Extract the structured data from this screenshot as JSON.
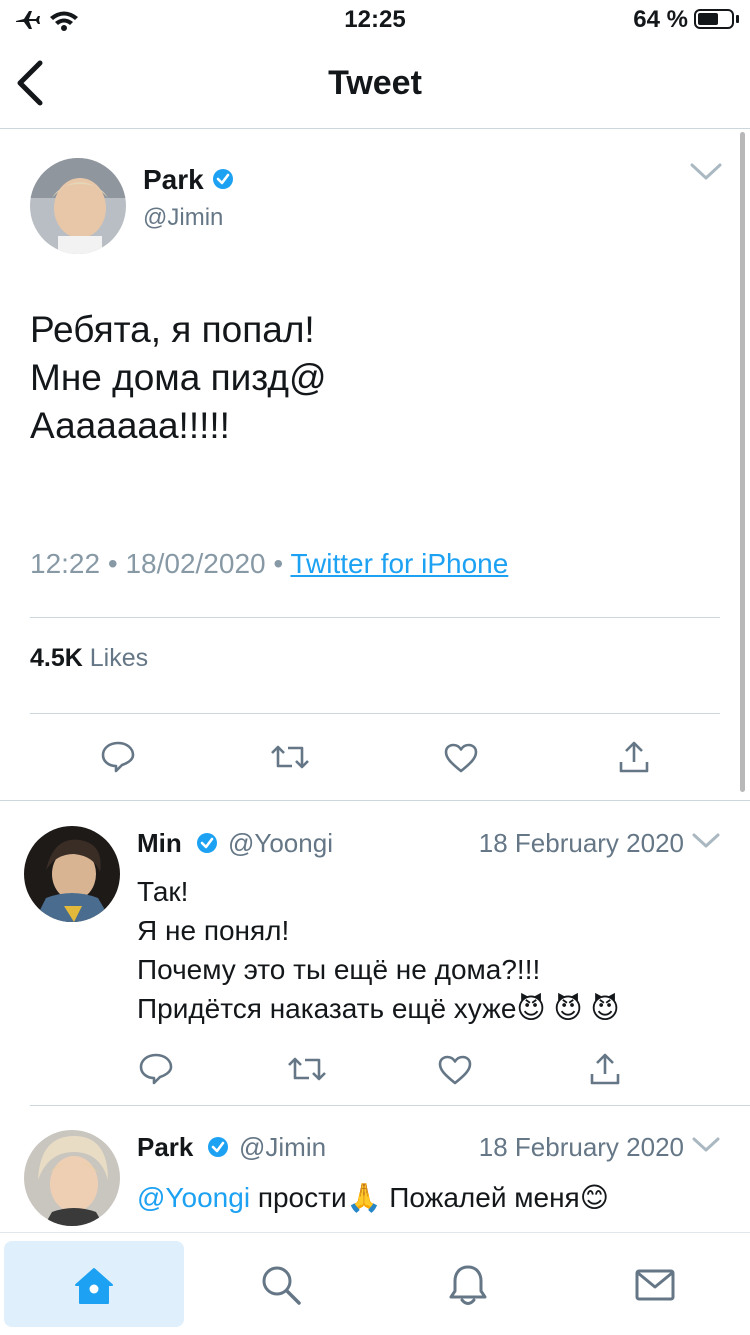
{
  "status_bar": {
    "time": "12:25",
    "battery_percent": "64 %",
    "battery_level": 0.64
  },
  "header": {
    "title": "Tweet"
  },
  "main_tweet": {
    "name": "Park",
    "handle": "@Jimin",
    "text": "Ребята, я попал!\nМне дома пизд@\nАаааааа!!!!!",
    "time": "12:22",
    "date": "18/02/2020",
    "source": "Twitter for iPhone",
    "likes_count": "4.5K",
    "likes_label": "Likes"
  },
  "replies": [
    {
      "name": "Min",
      "handle": "@Yoongi",
      "date": "18 February 2020",
      "text": "Так!\nЯ не понял!\nПочему это ты ещё не дома?!!!\nПридётся наказать ещё хуже😈 😈 😈"
    },
    {
      "name": "Park",
      "handle": "@Jimin",
      "date": "18 February 2020",
      "mention": "@Yoongi",
      "text": " прости🙏 Пожалей меня😊"
    }
  ],
  "tabs": [
    {
      "icon": "home-icon",
      "active": true
    },
    {
      "icon": "search-icon",
      "active": false
    },
    {
      "icon": "bell-icon",
      "active": false
    },
    {
      "icon": "mail-icon",
      "active": false
    }
  ],
  "colors": {
    "accent": "#1da1f2",
    "secondary_text": "#657786",
    "divider": "#ccd6dd"
  }
}
